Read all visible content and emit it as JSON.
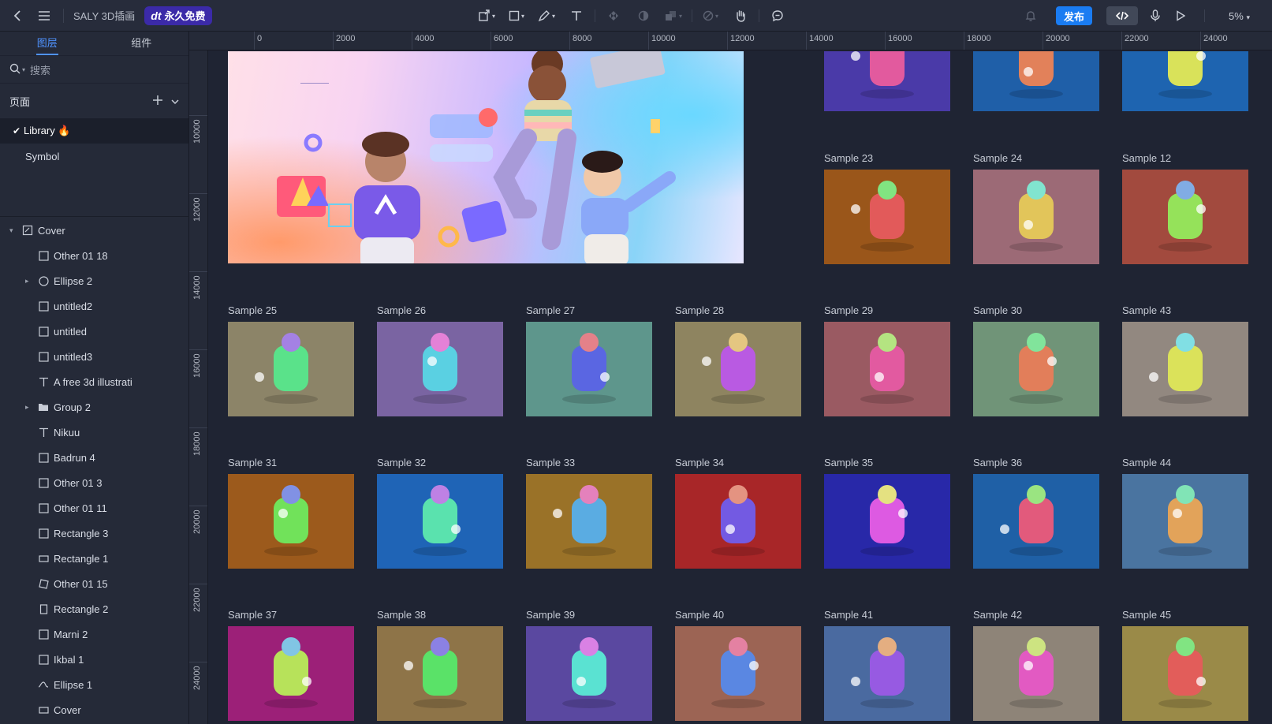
{
  "topbar": {
    "title": "SALY 3D插画",
    "promo_logo": "dt",
    "promo_text": "永久免费",
    "publish_label": "发布",
    "zoom": "5%"
  },
  "sidebar": {
    "tabs": [
      "图层",
      "组件"
    ],
    "search_placeholder": "搜索",
    "pages_label": "页面",
    "pages": [
      {
        "label": "Library 🔥",
        "selected": true
      },
      {
        "label": "Symbol",
        "selected": false
      }
    ],
    "layers": [
      {
        "label": "Cover",
        "icon": "page-icon",
        "level": 0,
        "expanded": true
      },
      {
        "label": "Other 01 18",
        "icon": "rect-icon",
        "level": 1
      },
      {
        "label": "Ellipse 2",
        "icon": "ellipse-icon",
        "level": 1,
        "collapsed": true
      },
      {
        "label": "untitled2",
        "icon": "rect-icon",
        "level": 1
      },
      {
        "label": "untitled",
        "icon": "rect-icon",
        "level": 1
      },
      {
        "label": "untitled3",
        "icon": "rect-icon",
        "level": 1
      },
      {
        "label": "A free 3d illustrati",
        "icon": "text-icon",
        "level": 1
      },
      {
        "label": "Group 2",
        "icon": "folder-icon",
        "level": 1,
        "collapsed": true
      },
      {
        "label": "Nikuu",
        "icon": "text-icon",
        "level": 1
      },
      {
        "label": "Badrun 4",
        "icon": "rect-icon",
        "level": 1
      },
      {
        "label": "Other 01 3",
        "icon": "rect-icon",
        "level": 1
      },
      {
        "label": "Other 01 11",
        "icon": "rect-icon",
        "level": 1
      },
      {
        "label": "Rectangle 3",
        "icon": "rect-icon",
        "level": 1
      },
      {
        "label": "Rectangle 1",
        "icon": "rect-wide-icon",
        "level": 1
      },
      {
        "label": "Other 01 15",
        "icon": "polygon-icon",
        "level": 1
      },
      {
        "label": "Rectangle 2",
        "icon": "rect-tall-icon",
        "level": 1
      },
      {
        "label": "Marni 2",
        "icon": "rect-icon",
        "level": 1
      },
      {
        "label": "Ikbal 1",
        "icon": "rect-icon",
        "level": 1
      },
      {
        "label": "Ellipse 1",
        "icon": "path-icon",
        "level": 1
      },
      {
        "label": "Cover",
        "icon": "rect-wide-icon",
        "level": 1
      }
    ]
  },
  "ruler": {
    "top": [
      "0",
      "2000",
      "4000",
      "6000",
      "8000",
      "10000",
      "12000",
      "14000",
      "16000",
      "18000",
      "20000",
      "22000",
      "24000"
    ],
    "left": [
      "10000",
      "12000",
      "14000",
      "16000",
      "18000",
      "20000",
      "22000",
      "24000"
    ]
  },
  "canvas": {
    "top_row": [
      {
        "color": "#4a3aa8"
      },
      {
        "color": "#1f5fa8"
      },
      {
        "color": "#1e64b0"
      }
    ],
    "samples": [
      {
        "label": "Sample 23",
        "color": "#9a561a"
      },
      {
        "label": "Sample 24",
        "color": "#9c6a76"
      },
      {
        "label": "Sample 12",
        "color": "#a24a3e"
      },
      {
        "label": "Sample 25",
        "color": "#8c8468"
      },
      {
        "label": "Sample 26",
        "color": "#7a64a2"
      },
      {
        "label": "Sample 27",
        "color": "#5e968c"
      },
      {
        "label": "Sample 28",
        "color": "#8e8460"
      },
      {
        "label": "Sample 29",
        "color": "#9a5a62"
      },
      {
        "label": "Sample 30",
        "color": "#709478"
      },
      {
        "label": "Sample 43",
        "color": "#928880"
      },
      {
        "label": "Sample 31",
        "color": "#9c5a1c"
      },
      {
        "label": "Sample 32",
        "color": "#1f64b6"
      },
      {
        "label": "Sample 33",
        "color": "#9a7228"
      },
      {
        "label": "Sample 34",
        "color": "#a82628"
      },
      {
        "label": "Sample 35",
        "color": "#2828a8"
      },
      {
        "label": "Sample 36",
        "color": "#1f60a6"
      },
      {
        "label": "Sample 44",
        "color": "#4a74a0"
      },
      {
        "label": "Sample 37",
        "color": "#9c2078"
      },
      {
        "label": "Sample 38",
        "color": "#8e7448"
      },
      {
        "label": "Sample 39",
        "color": "#5a48a0"
      },
      {
        "label": "Sample 40",
        "color": "#9c6454"
      },
      {
        "label": "Sample 41",
        "color": "#4a6aa0"
      },
      {
        "label": "Sample 42",
        "color": "#8e8478"
      },
      {
        "label": "Sample 45",
        "color": "#9a8a48"
      }
    ]
  }
}
